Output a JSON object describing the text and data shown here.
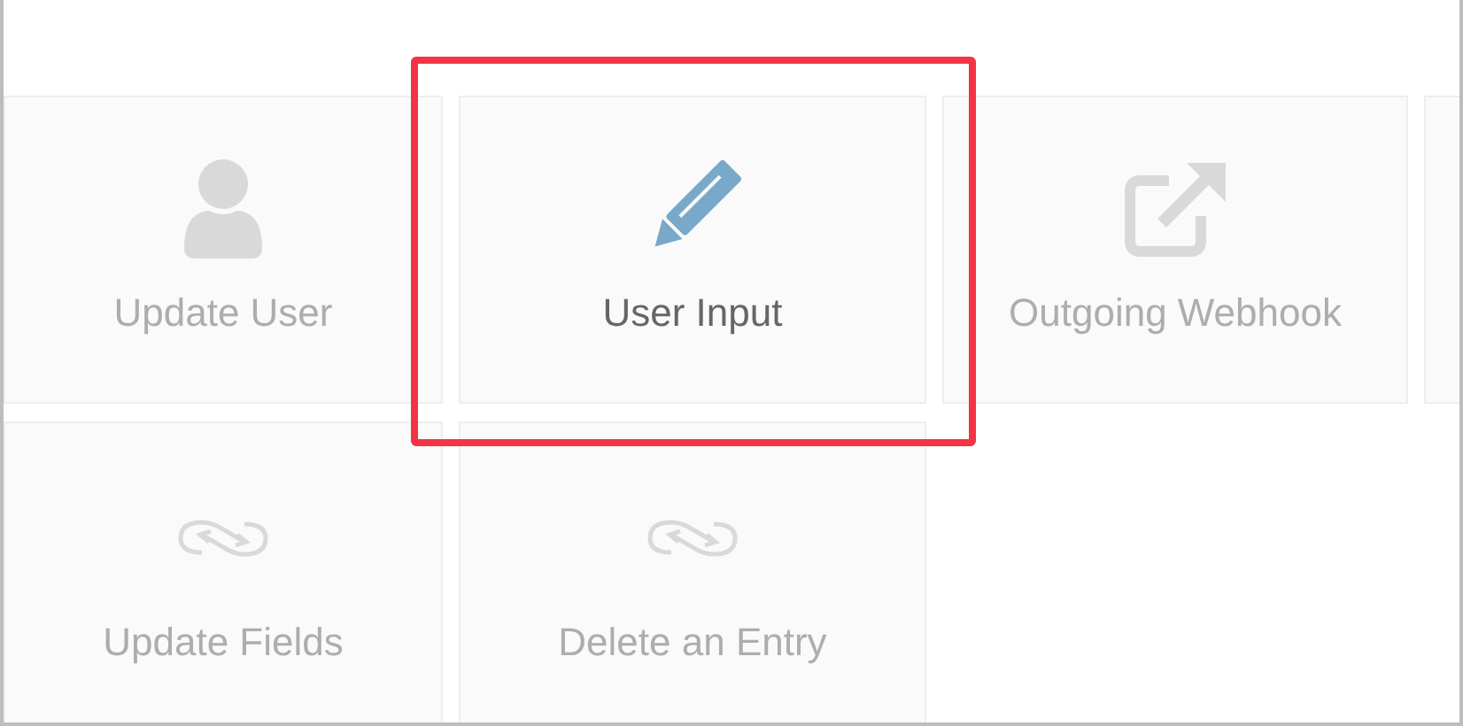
{
  "tiles": [
    {
      "kind": "user",
      "label": "Update User",
      "selected": false
    },
    {
      "kind": "pencil",
      "label": "User Input",
      "selected": true
    },
    {
      "kind": "external-link",
      "label": "Outgoing Webhook",
      "selected": false
    },
    {
      "kind": "blank",
      "selected": false
    },
    {
      "kind": "sync-link",
      "label": "Update Fields",
      "selected": false
    },
    {
      "kind": "sync-link",
      "label": "Delete an Entry",
      "selected": false
    }
  ]
}
